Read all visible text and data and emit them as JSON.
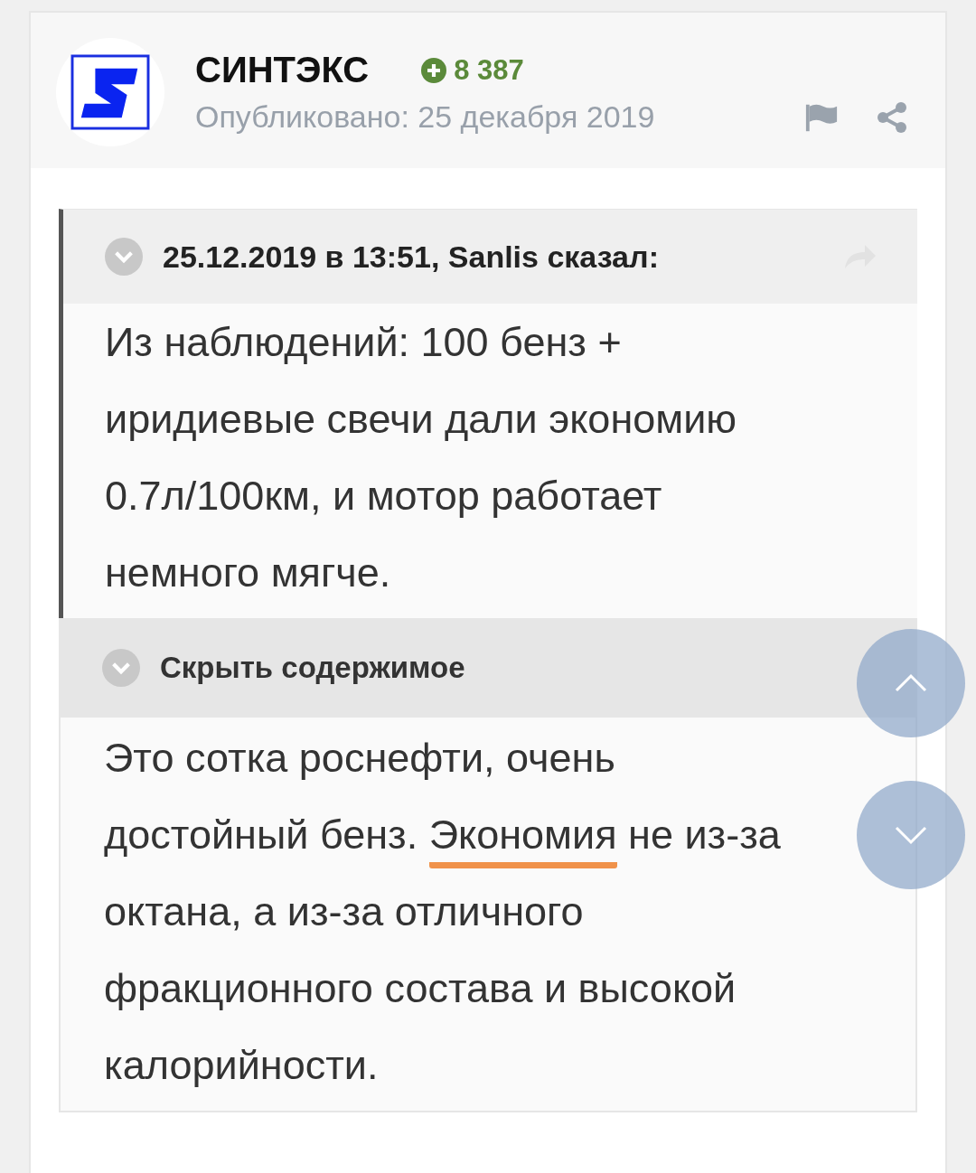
{
  "post": {
    "author": "СИНТЭКС",
    "reputation": "8 387",
    "published": "Опубликовано: 25 декабря 2019"
  },
  "quote": {
    "header": "25.12.2019 в 13:51, Sanlis сказал:",
    "text": "Из наблюдений: 100 бенз + иридиевые свечи дали экономию 0.7л/100км, и мотор работает немного мягче."
  },
  "spoiler": {
    "label": "Скрыть содержимое",
    "expanded": true
  },
  "reply": [
    {
      "text": "Это сотка роснефти, очень достойный бенз. ",
      "underlined": false
    },
    {
      "text": "Экономия",
      "underlined": true
    },
    {
      "text": " не из-за октана, а из-за отличного фракционного состава и высокой калорийности.",
      "underlined": false
    }
  ]
}
